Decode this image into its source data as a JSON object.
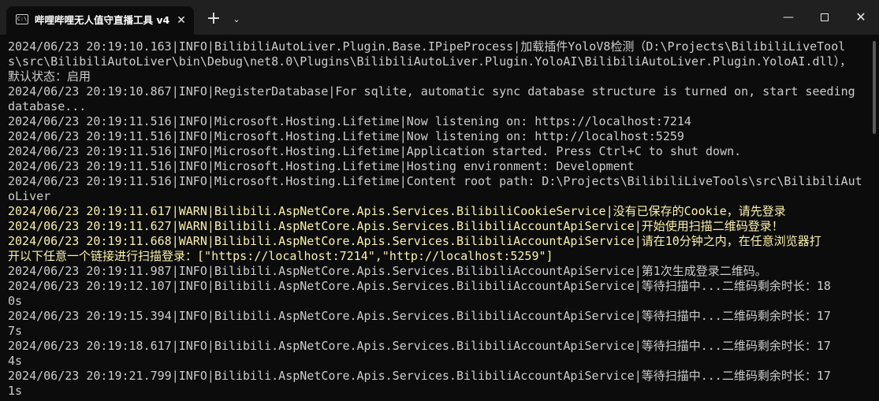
{
  "titlebar": {
    "tab_icon": "C:\\",
    "tab_title": "哔哩哔哩无人值守直播工具 v4.",
    "tab_close": "✕",
    "new_tab": "+",
    "dropdown": "⌄",
    "minimize": "—",
    "close": "✕"
  },
  "colors": {
    "info_text": "#cccccc",
    "warn_text": "#f9f1a5",
    "background": "#0c0c0c",
    "titlebar": "#202020"
  },
  "console": {
    "lines": [
      {
        "text": "2024/06/23 20:19:10.163|INFO|BilibiliAutoLiver.Plugin.Base.IPipeProcess|加载插件YoloV8检测（D:\\Projects\\BilibiliLiveTool",
        "level": "info"
      },
      {
        "text": "s\\src\\BilibiliAutoLiver\\bin\\Debug\\net8.0\\Plugins\\BilibiliAutoLiver.Plugin.YoloAI\\BilibiliAutoLiver.Plugin.YoloAI.dll），",
        "level": "info"
      },
      {
        "text": "默认状态：启用",
        "level": "info"
      },
      {
        "text": "2024/06/23 20:19:10.867|INFO|RegisterDatabase|For sqlite, automatic sync database structure is turned on, start seeding",
        "level": "info"
      },
      {
        "text": "database...",
        "level": "info"
      },
      {
        "text": "2024/06/23 20:19:11.516|INFO|Microsoft.Hosting.Lifetime|Now listening on: https://localhost:7214",
        "level": "info"
      },
      {
        "text": "2024/06/23 20:19:11.516|INFO|Microsoft.Hosting.Lifetime|Now listening on: http://localhost:5259",
        "level": "info"
      },
      {
        "text": "2024/06/23 20:19:11.516|INFO|Microsoft.Hosting.Lifetime|Application started. Press Ctrl+C to shut down.",
        "level": "info"
      },
      {
        "text": "2024/06/23 20:19:11.516|INFO|Microsoft.Hosting.Lifetime|Hosting environment: Development",
        "level": "info"
      },
      {
        "text": "2024/06/23 20:19:11.516|INFO|Microsoft.Hosting.Lifetime|Content root path: D:\\Projects\\BilibiliLiveTools\\src\\BilibiliAut",
        "level": "info"
      },
      {
        "text": "oLiver",
        "level": "info"
      },
      {
        "text": "2024/06/23 20:19:11.617|WARN|Bilibili.AspNetCore.Apis.Services.BilibiliCookieService|没有已保存的Cookie，请先登录",
        "level": "warn"
      },
      {
        "text": "2024/06/23 20:19:11.627|WARN|Bilibili.AspNetCore.Apis.Services.BilibiliAccountApiService|开始使用扫描二维码登录！",
        "level": "warn"
      },
      {
        "text": "2024/06/23 20:19:11.668|WARN|Bilibili.AspNetCore.Apis.Services.BilibiliAccountApiService|请在10分钟之内，在任意浏览器打",
        "level": "warn"
      },
      {
        "text": "开以下任意一个链接进行扫描登录：[\"https://localhost:7214\",\"http://localhost:5259\"]",
        "level": "warn"
      },
      {
        "text": "2024/06/23 20:19:11.987|INFO|Bilibili.AspNetCore.Apis.Services.BilibiliAccountApiService|第1次生成登录二维码。",
        "level": "info"
      },
      {
        "text": "2024/06/23 20:19:12.107|INFO|Bilibili.AspNetCore.Apis.Services.BilibiliAccountApiService|等待扫描中...二维码剩余时长：18",
        "level": "info"
      },
      {
        "text": "0s",
        "level": "info"
      },
      {
        "text": "2024/06/23 20:19:15.394|INFO|Bilibili.AspNetCore.Apis.Services.BilibiliAccountApiService|等待扫描中...二维码剩余时长：17",
        "level": "info"
      },
      {
        "text": "7s",
        "level": "info"
      },
      {
        "text": "2024/06/23 20:19:18.617|INFO|Bilibili.AspNetCore.Apis.Services.BilibiliAccountApiService|等待扫描中...二维码剩余时长：17",
        "level": "info"
      },
      {
        "text": "4s",
        "level": "info"
      },
      {
        "text": "2024/06/23 20:19:21.799|INFO|Bilibili.AspNetCore.Apis.Services.BilibiliAccountApiService|等待扫描中...二维码剩余时长：17",
        "level": "info"
      },
      {
        "text": "1s",
        "level": "info"
      }
    ]
  }
}
